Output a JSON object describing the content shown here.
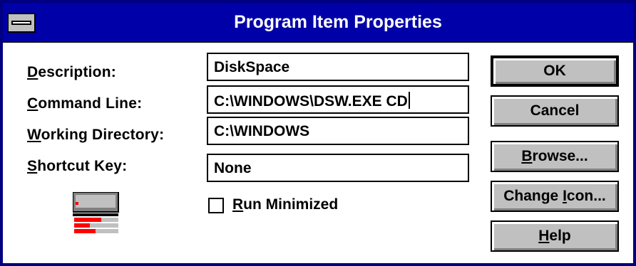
{
  "window": {
    "title": "Program Item Properties"
  },
  "labels": {
    "description": {
      "mnemonic": "D",
      "rest": "escription:"
    },
    "command_line": {
      "mnemonic": "C",
      "rest": "ommand Line:"
    },
    "working_directory": {
      "mnemonic": "W",
      "rest": "orking Directory:"
    },
    "shortcut_key": {
      "mnemonic": "S",
      "rest": "hortcut Key:"
    }
  },
  "fields": {
    "description": "DiskSpace",
    "command_line": "C:\\WINDOWS\\DSW.EXE CD",
    "working_directory": "C:\\WINDOWS",
    "shortcut_key": "None"
  },
  "checkbox": {
    "run_minimized": {
      "mnemonic": "R",
      "rest": "un Minimized",
      "checked": false
    }
  },
  "buttons": {
    "ok": "OK",
    "cancel": "Cancel",
    "browse": {
      "mnemonic": "B",
      "rest": "rowse..."
    },
    "change_icon": {
      "pre": "Change ",
      "mnemonic": "I",
      "rest": "con..."
    },
    "help": {
      "mnemonic": "H",
      "rest": "elp"
    }
  },
  "icon": {
    "name": "program-item-icon",
    "accent": "#ff0000",
    "body": "#808080"
  }
}
